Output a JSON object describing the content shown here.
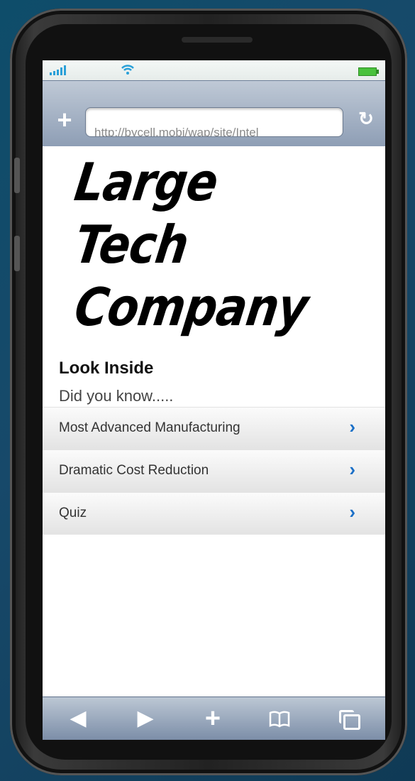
{
  "browser": {
    "url": "http://bycell.mobi/wap/site/Intel"
  },
  "logo": {
    "lines": [
      "Large",
      "Tech",
      "Company"
    ]
  },
  "content": {
    "heading": "Look Inside",
    "subheading": "Did you know.....",
    "items": [
      {
        "label": "Most Advanced Manufacturing"
      },
      {
        "label": "Dramatic Cost Reduction"
      },
      {
        "label": "Quiz"
      }
    ]
  },
  "icons": {
    "chevron": "chevron-right-icon",
    "toolbar": [
      "back-icon",
      "forward-icon",
      "add-icon",
      "bookmarks-icon",
      "tabs-icon"
    ]
  },
  "colors": {
    "accent": "#1a6fc7",
    "battery": "#49c13c",
    "signal": "#2aa0d8"
  }
}
